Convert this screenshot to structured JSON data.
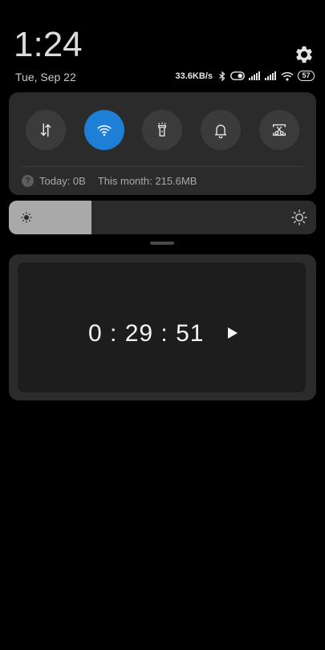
{
  "header": {
    "time": "1:24",
    "date": "Tue, Sep 22",
    "network_speed": "33.6KB/s",
    "battery_level": "57",
    "settings_icon": "gear-icon"
  },
  "quick_settings": {
    "tiles": [
      {
        "name": "mobile-data",
        "icon": "data-arrows-icon",
        "active": false
      },
      {
        "name": "wifi",
        "icon": "wifi-icon",
        "active": true
      },
      {
        "name": "flashlight",
        "icon": "flashlight-icon",
        "active": false
      },
      {
        "name": "sound",
        "icon": "bell-icon",
        "active": false
      },
      {
        "name": "screenshot",
        "icon": "screenshot-scissors-icon",
        "active": false
      }
    ],
    "usage": {
      "today": "Today: 0B",
      "month": "This month: 215.6MB"
    },
    "accent_color": "#1e7fd6"
  },
  "brightness": {
    "level_percent": 27
  },
  "timer": {
    "display": "0 : 29 : 51",
    "play_icon": "play-icon"
  }
}
